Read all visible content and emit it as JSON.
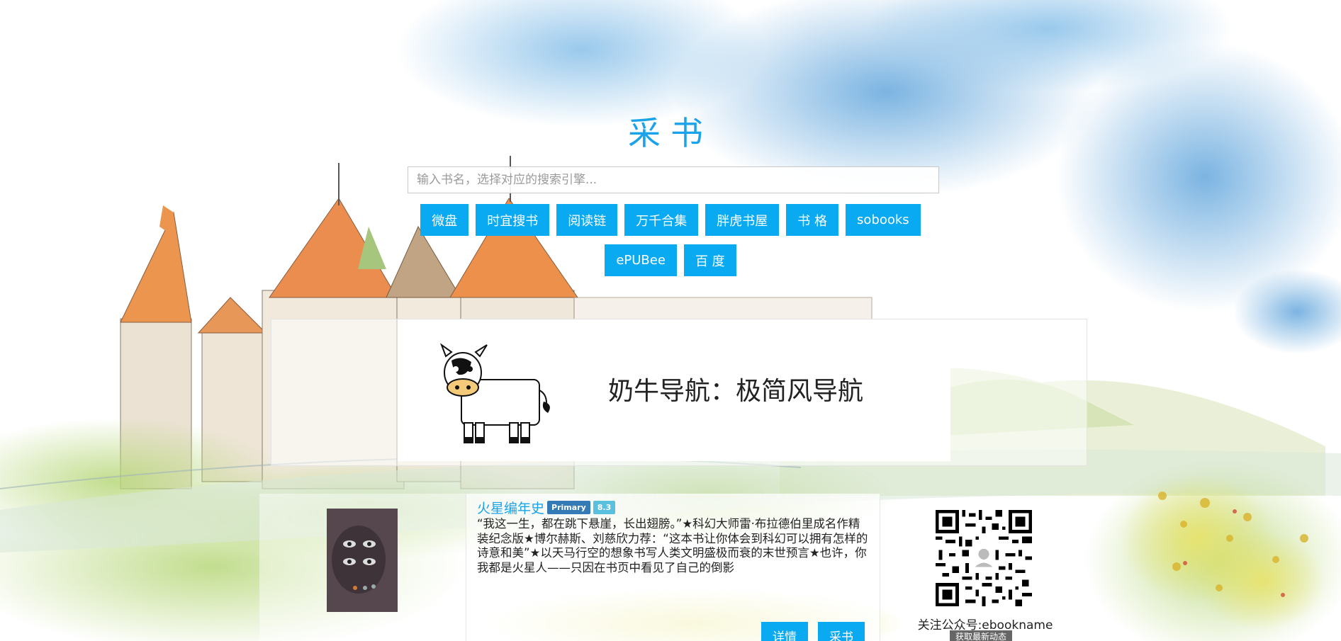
{
  "site": {
    "title": "采书"
  },
  "search": {
    "placeholder": "输入书名，选择对应的搜索引擎...",
    "value": ""
  },
  "engines": [
    {
      "label": "微盘"
    },
    {
      "label": "时宜搜书"
    },
    {
      "label": "阅读链"
    },
    {
      "label": "万千合集"
    },
    {
      "label": "胖虎书屋"
    },
    {
      "label": "书 格"
    },
    {
      "label": "sobooks"
    },
    {
      "label": "ePUBee"
    },
    {
      "label": "百 度"
    }
  ],
  "banner": {
    "text": "奶牛导航：极简风导航"
  },
  "book": {
    "title": "火星编年史",
    "badge_primary": "Primary",
    "badge_score": "8.3",
    "description": "“我这一生，都在跳下悬崖，长出翅膀。”★科幻大师雷·布拉德伯里成名作精装纪念版★博尔赫斯、刘慈欣力荐：“这本书让你体会到科幻可以拥有怎样的诗意和美”★以天马行空的想象书写人类文明盛极而衰的末世预言★也许，你我都是火星人——只因在书页中看见了自己的倒影",
    "details_label": "详情",
    "collect_label": "采书"
  },
  "qr": {
    "caption": "关注公众号:ebookname",
    "tag": "获取最新动态"
  },
  "colors": {
    "accent": "#0aaaf2",
    "title": "#1aa3ea"
  }
}
